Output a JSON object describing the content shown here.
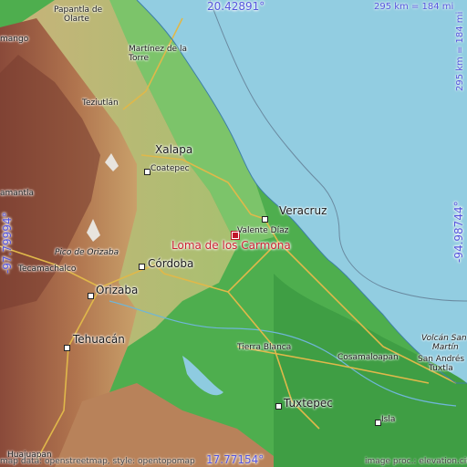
{
  "place": {
    "name": "Loma de los Carmona",
    "marker_color": "#c0152a"
  },
  "coordinates": {
    "top": "20.42891°",
    "bottom": "17.77154°",
    "left": "-97.79994°",
    "right": "-94.98744°"
  },
  "scale": {
    "horizontal": "295 km = 184 mi",
    "vertical": "295 km = 184 mi"
  },
  "cities": {
    "papantla": "Papantla de",
    "olarte": "Olarte",
    "martinez1": "Martínez de la",
    "martinez2": "Torre",
    "teziutlan": "Teziutlán",
    "xalapa": "Xalapa",
    "coatepec": "Coatepec",
    "veracruz": "Veracruz",
    "valente": "Valente Díaz",
    "cordoba": "Córdoba",
    "orizaba": "Orizaba",
    "pico": "Pico de Orizaba",
    "tecamachalco": "Tecamachalco",
    "tehuacan": "Tehuacán",
    "tierra_blanca": "Tierra Blanca",
    "cosamaloapan": "Cosamaloapan",
    "volcan1": "Volcán San",
    "volcan2": "Martín",
    "san_andres1": "San Andrés",
    "san_andres2": "Tuxtla",
    "tuxtepec": "Tuxtepec",
    "isla": "Isla",
    "huajuapan": "Huajuapan",
    "mango": "mango",
    "amantla": "amantla"
  },
  "footer": {
    "left": "map data: openstreetmap, style: opentopomap",
    "right": "image proc.: elevation.city"
  },
  "colors": {
    "sea": "#90cde0",
    "lowland": "#4caf50",
    "coord_text": "#5555dd",
    "place_text": "#cc2233"
  }
}
